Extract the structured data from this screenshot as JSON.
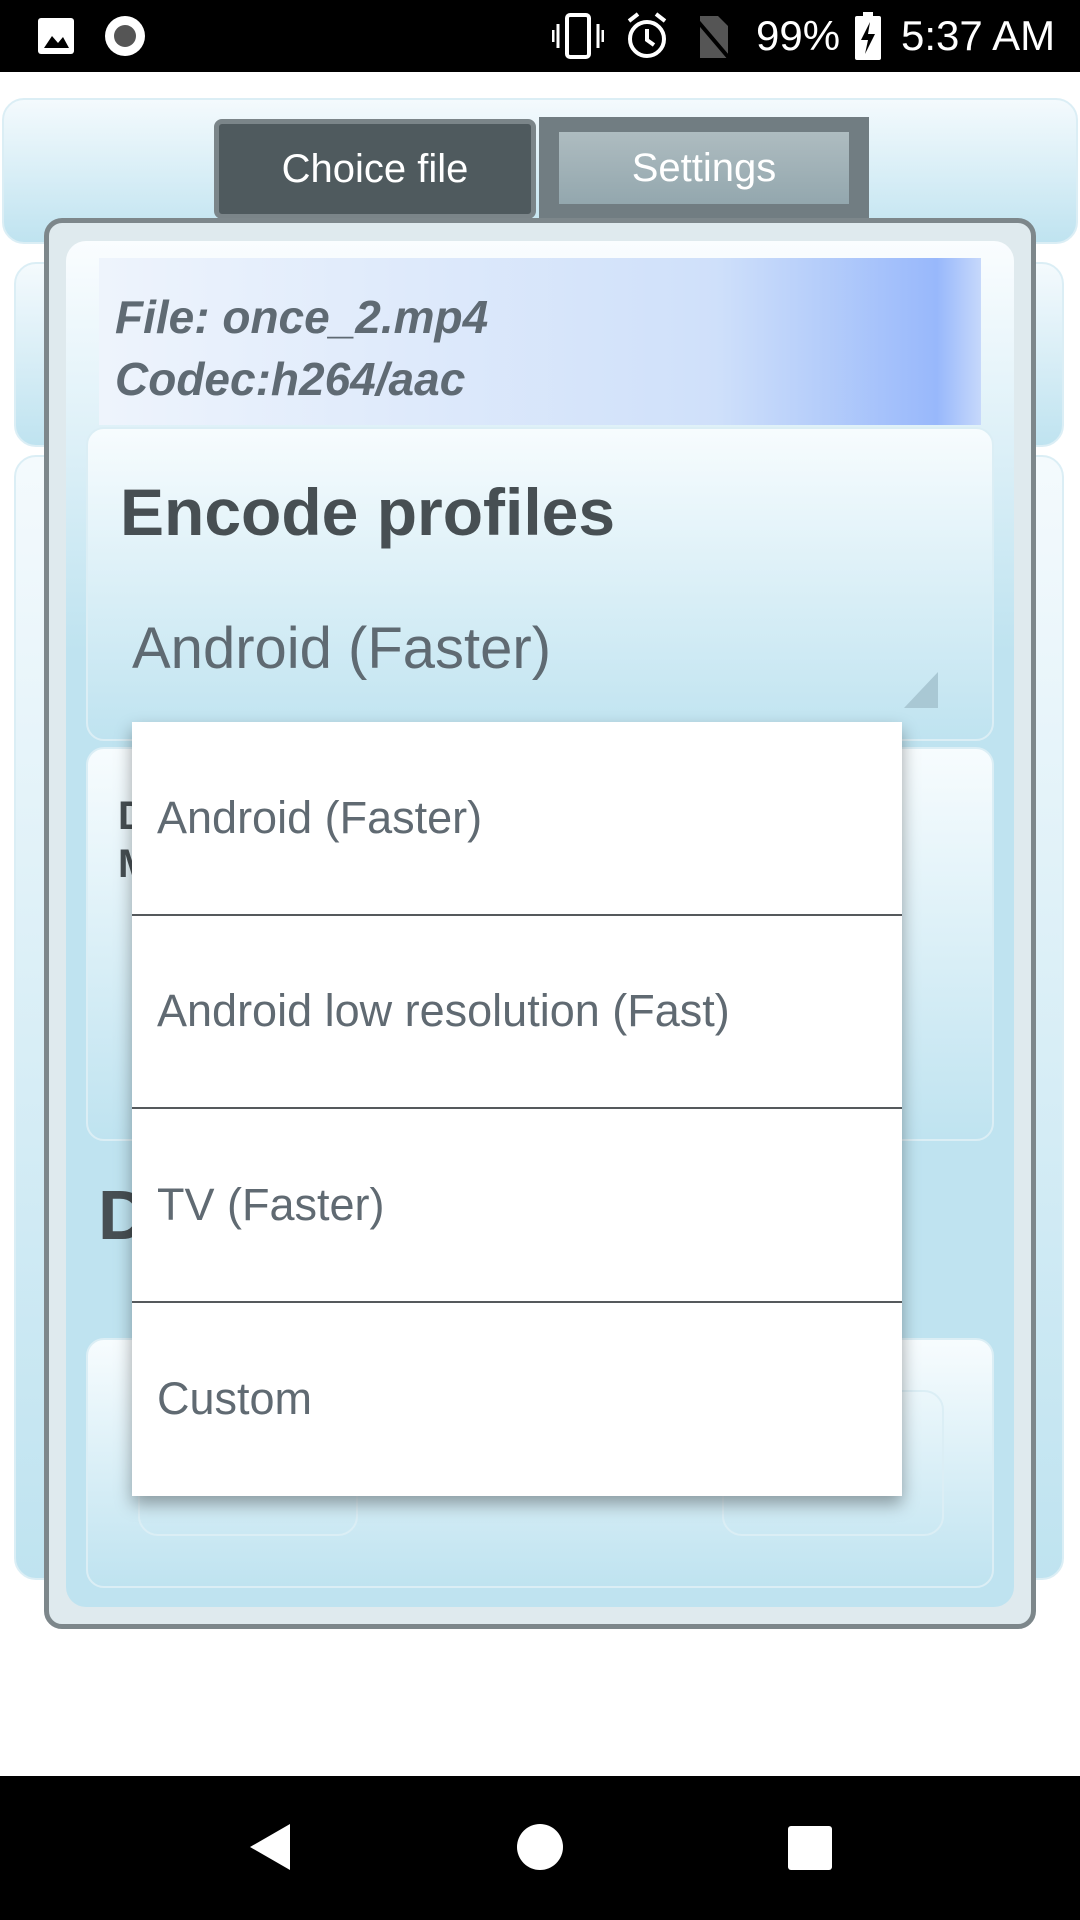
{
  "status_bar": {
    "battery": "99%",
    "time": "5:37 AM",
    "icons": [
      "image-icon",
      "record-icon",
      "vibrate-icon",
      "alarm-icon",
      "no-sim-icon",
      "battery-charging-icon"
    ]
  },
  "tabs": [
    {
      "label": "Choice file"
    },
    {
      "label": "Settings"
    }
  ],
  "file_info": {
    "file": "File: once_2.mp4",
    "codec": "Codec:h264/aac"
  },
  "encode_profiles": {
    "title": "Encode profiles",
    "selected": "Android (Faster)"
  },
  "background_fragments": {
    "a": "D",
    "b": "M",
    "c": "D"
  },
  "dropdown": {
    "options": [
      "Android (Faster)",
      "Android low resolution (Fast)",
      "TV (Faster)",
      "Custom"
    ]
  },
  "nav": {
    "icons": [
      "back-icon",
      "home-icon",
      "recents-icon"
    ]
  }
}
